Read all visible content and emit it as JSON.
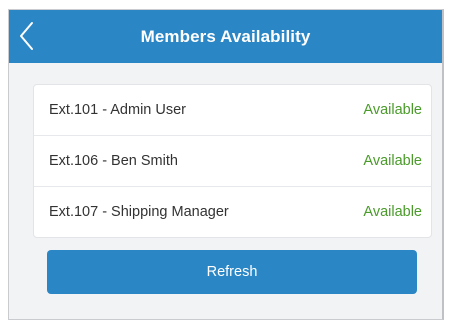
{
  "header": {
    "title": "Members Availability",
    "back_icon": "chevron-left-icon"
  },
  "members": [
    {
      "name": "Ext.101 - Admin User",
      "status": "Available"
    },
    {
      "name": "Ext.106 - Ben Smith",
      "status": "Available"
    },
    {
      "name": "Ext.107 - Shipping Manager",
      "status": "Available"
    }
  ],
  "actions": {
    "refresh_label": "Refresh"
  },
  "colors": {
    "accent": "#2b86c5",
    "status_available": "#4a9b2a",
    "background": "#f2f3f5"
  }
}
